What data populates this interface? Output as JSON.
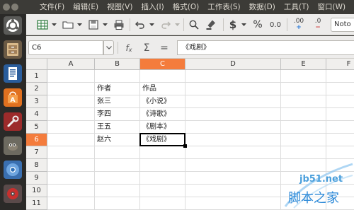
{
  "menu": [
    "文件(F)",
    "编辑(E)",
    "视图(V)",
    "插入(I)",
    "格式(O)",
    "工作表(S)",
    "数据(D)",
    "工具(T)",
    "窗口(W)"
  ],
  "toolbar": {
    "font_name": "Noto",
    "currency_label": "$",
    "percent_label": "%",
    "decimal_label": "0.0",
    "add_decimal_label": ".00",
    "remove_decimal_label": ".0"
  },
  "formula_bar": {
    "cell_ref": "C6",
    "fx_label": "f",
    "sum_label": "Σ",
    "equals_label": "=",
    "content": "《戏剧》"
  },
  "sheet": {
    "columns": [
      "A",
      "B",
      "C",
      "D",
      "E",
      "F"
    ],
    "rows": [
      "1",
      "2",
      "3",
      "4",
      "5",
      "6",
      "7",
      "8",
      "9",
      "10",
      "11"
    ],
    "active_column": "C",
    "active_row": "6",
    "cells": [
      {
        "ref": "B2",
        "value": "作者"
      },
      {
        "ref": "C2",
        "value": "作品"
      },
      {
        "ref": "B3",
        "value": "张三"
      },
      {
        "ref": "C3",
        "value": "《小说》"
      },
      {
        "ref": "B4",
        "value": "李四"
      },
      {
        "ref": "C4",
        "value": "《诗歌》"
      },
      {
        "ref": "B5",
        "value": "王五"
      },
      {
        "ref": "C5",
        "value": "《剧本》"
      },
      {
        "ref": "B6",
        "value": "赵六"
      },
      {
        "ref": "C6",
        "value": "《戏剧》"
      }
    ]
  },
  "watermark": {
    "url": "jb51.net",
    "name": "脚本之家"
  },
  "colors": {
    "active_header": "#f47c3c",
    "launcher_bg": "#2b2a28",
    "menubar_bg": "#3c3b37"
  }
}
